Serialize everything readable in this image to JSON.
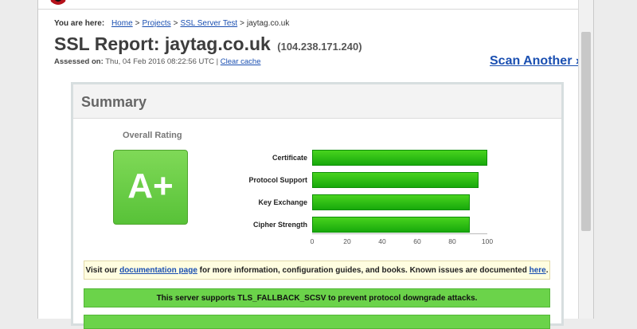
{
  "breadcrumb": {
    "label": "You are here:",
    "home": "Home",
    "projects": "Projects",
    "ssl_test": "SSL Server Test",
    "current": "jaytag.co.uk"
  },
  "report": {
    "title": "SSL Report: jaytag.co.uk",
    "ip": "(104.238.171.240)",
    "assessed_label": "Assessed on:",
    "assessed_value": "Thu, 04 Feb 2016 08:22:56 UTC",
    "divider": "|",
    "clear_cache": "Clear cache",
    "scan_another": "Scan Another »"
  },
  "summary": {
    "title": "Summary",
    "overall_label": "Overall Rating",
    "grade": "A+",
    "grade_color": "#5fc93d"
  },
  "chart_data": {
    "type": "bar",
    "orientation": "horizontal",
    "categories": [
      "Certificate",
      "Protocol Support",
      "Key Exchange",
      "Cipher Strength"
    ],
    "values": [
      100,
      95,
      90,
      90
    ],
    "xlim": [
      0,
      100
    ],
    "xticks": [
      "0",
      "20",
      "40",
      "60",
      "80",
      "100"
    ],
    "bar_color": "#2dbd14"
  },
  "notices": {
    "doc_prefix": "Visit our ",
    "doc_link": "documentation page",
    "doc_suffix": " for more information, configuration guides, and books. Known issues are documented ",
    "here_link": "here",
    "doc_end": ".",
    "fallback": "This server supports TLS_FALLBACK_SCSV to prevent protocol downgrade attacks."
  }
}
